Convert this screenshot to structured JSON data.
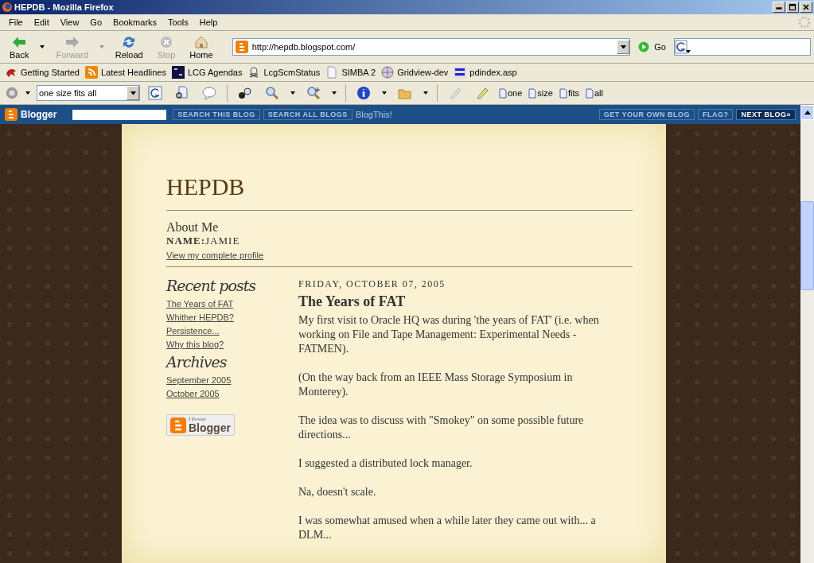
{
  "window": {
    "title": "HEPDB - Mozilla Firefox"
  },
  "menu": [
    "File",
    "Edit",
    "View",
    "Go",
    "Bookmarks",
    "Tools",
    "Help"
  ],
  "nav_buttons": [
    {
      "kind": "back",
      "label": "Back",
      "disabled": false,
      "dropdown": true
    },
    {
      "kind": "forward",
      "label": "Forward",
      "disabled": true,
      "dropdown": true
    },
    {
      "kind": "reload",
      "label": "Reload",
      "disabled": false,
      "dropdown": false
    },
    {
      "kind": "stop",
      "label": "Stop",
      "disabled": true,
      "dropdown": false
    },
    {
      "kind": "home",
      "label": "Home",
      "disabled": false,
      "dropdown": false
    }
  ],
  "address": {
    "value": "http://hepdb.blogspot.com/"
  },
  "go_button": {
    "label": "Go"
  },
  "bookmarks": [
    {
      "kind": "bird",
      "label": "Getting Started"
    },
    {
      "kind": "feed",
      "label": "Latest Headlines"
    },
    {
      "kind": "cds",
      "label": "LCG Agendas"
    },
    {
      "kind": "skull",
      "label": "LcgScmStatus"
    },
    {
      "kind": "page",
      "label": "SIMBA 2"
    },
    {
      "kind": "grid",
      "label": "Gridview-dev"
    },
    {
      "kind": "who",
      "label": "pdindex.asp"
    }
  ],
  "google_toolbar": {
    "combo_value": "one size fits all",
    "highlight_buttons": [
      "one",
      "size",
      "fits",
      "all"
    ]
  },
  "blogger_bar": {
    "logo": "Blogger",
    "search_this": "SEARCH THIS BLOG",
    "search_all": "SEARCH ALL BLOGS",
    "blog_this": "BlogThis!",
    "get_own": "GET YOUR OWN BLOG",
    "flag": "FLAG?",
    "next": "NEXT BLOG»"
  },
  "blog": {
    "title": "HEPDB",
    "about": {
      "heading": "About Me",
      "name_label": "NAME:",
      "name": "JAMIE",
      "profile_link": "View my complete profile"
    },
    "recent_heading": "Recent posts",
    "recent_posts": [
      "The Years of FAT",
      "Whither HEPDB?",
      "Persistence...",
      "Why this blog?"
    ],
    "archives_heading": "Archives",
    "archives": [
      "September 2005",
      "October 2005"
    ],
    "badge": {
      "small": "I Power",
      "big": "Blogger"
    },
    "post": {
      "date": "FRIDAY, OCTOBER 07, 2005",
      "title": "The Years of FAT",
      "paragraphs": [
        "My first visit to Oracle HQ was during 'the years of FAT' (i.e. when working on File and Tape Management: Experimental Needs - FATMEN).",
        "(On the way back from an IEEE Mass Storage Symposium in Monterey).",
        "The idea was to discuss with \"Smokey\" on some possible future directions...",
        "I suggested a distributed lock manager.",
        "Na, doesn't scale.",
        "I was somewhat amused when a while later they came out with... a DLM..."
      ]
    }
  }
}
